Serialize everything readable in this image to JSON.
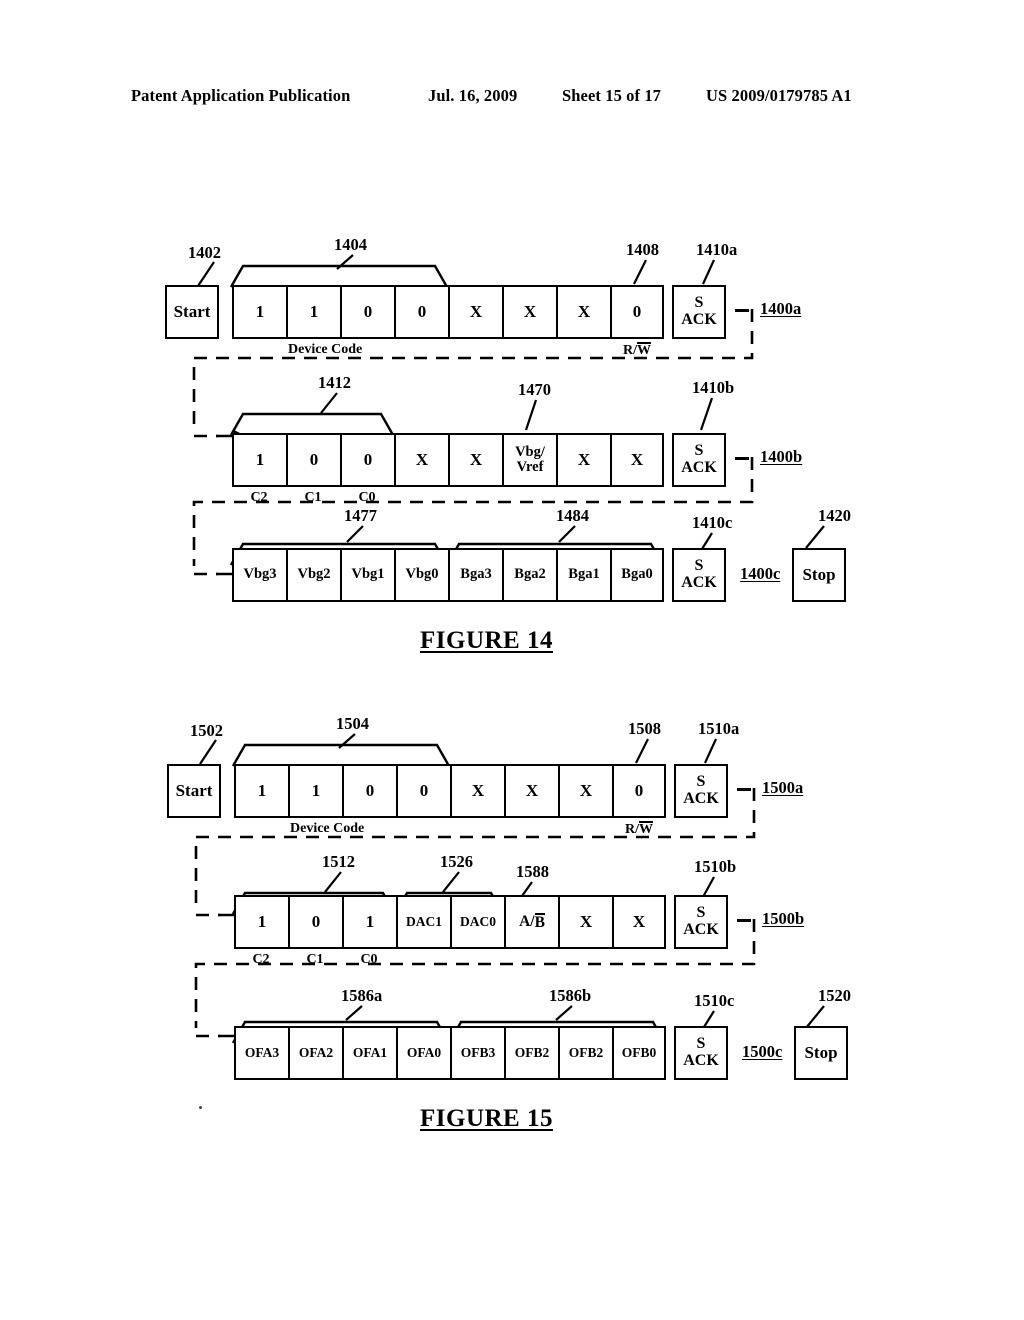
{
  "header": {
    "publication": "Patent Application Publication",
    "date": "Jul. 16, 2009",
    "sheet": "Sheet 15 of 17",
    "patent_number": "US 2009/0179785 A1"
  },
  "figures": [
    {
      "title": "FIGURE 14",
      "rows": [
        {
          "start_label": "Start",
          "start_ref": "1402",
          "cells": [
            "1",
            "1",
            "0",
            "0",
            "X",
            "X",
            "X",
            "0"
          ],
          "brace_refs": [
            "1404"
          ],
          "pointer_ref": "1408",
          "ack_label_top": "S",
          "ack_label_bottom": "ACK",
          "ack_ref": "1410a",
          "frame_label": "1400a",
          "caption_left": "Device Code",
          "caption_right": "R/W",
          "caption_right_overline": "W"
        },
        {
          "cells": [
            "1",
            "0",
            "0",
            "X",
            "X",
            "Vbg/ Vref",
            "X",
            "X"
          ],
          "brace_refs": [
            "1412"
          ],
          "pointer_ref": "1470",
          "ack_label_top": "S",
          "ack_label_bottom": "ACK",
          "ack_ref": "1410b",
          "frame_label": "1400b",
          "bit_captions": [
            "C2",
            "C1",
            "C0"
          ]
        },
        {
          "cells": [
            "Vbg3",
            "Vbg2",
            "Vbg1",
            "Vbg0",
            "Bga3",
            "Bga2",
            "Bga1",
            "Bga0"
          ],
          "brace_refs": [
            "1477",
            "1484"
          ],
          "ack_label_top": "S",
          "ack_label_bottom": "ACK",
          "ack_ref": "1410c",
          "frame_label": "1400c",
          "stop_label": "Stop",
          "stop_ref": "1420"
        }
      ]
    },
    {
      "title": "FIGURE 15",
      "rows": [
        {
          "start_label": "Start",
          "start_ref": "1502",
          "cells": [
            "1",
            "1",
            "0",
            "0",
            "X",
            "X",
            "X",
            "0"
          ],
          "brace_refs": [
            "1504"
          ],
          "pointer_ref": "1508",
          "ack_label_top": "S",
          "ack_label_bottom": "ACK",
          "ack_ref": "1510a",
          "frame_label": "1500a",
          "caption_left": "Device Code",
          "caption_right": "R/W",
          "caption_right_overline": "W"
        },
        {
          "cells": [
            "1",
            "0",
            "1",
            "DAC1",
            "DAC0",
            "A/B",
            "X",
            "X"
          ],
          "cell_overline_index": 5,
          "cell_overline_text": "B",
          "brace_refs": [
            "1512",
            "1526"
          ],
          "pointer_ref": "1588",
          "ack_label_top": "S",
          "ack_label_bottom": "ACK",
          "ack_ref": "1510b",
          "frame_label": "1500b",
          "bit_captions": [
            "C2",
            "C1",
            "C0"
          ]
        },
        {
          "cells": [
            "OFA3",
            "OFA2",
            "OFA1",
            "OFA0",
            "OFB3",
            "OFB2",
            "OFB2",
            "OFB0"
          ],
          "brace_refs": [
            "1586a",
            "1586b"
          ],
          "ack_label_top": "S",
          "ack_label_bottom": "ACK",
          "ack_ref": "1510c",
          "frame_label": "1500c",
          "stop_label": "Stop",
          "stop_ref": "1520"
        }
      ]
    }
  ]
}
